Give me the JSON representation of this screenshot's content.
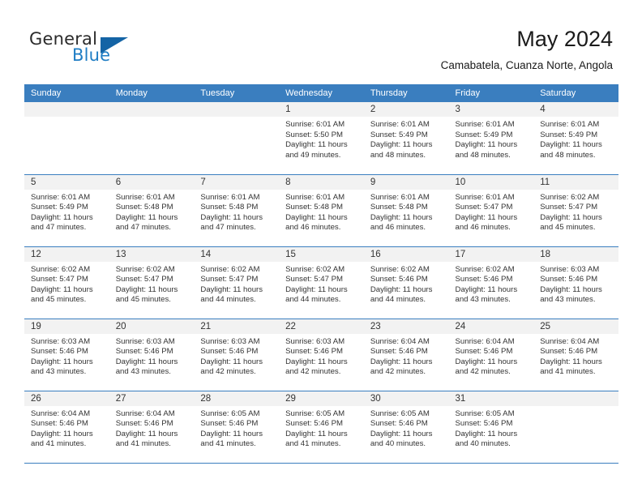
{
  "brand": {
    "name_part1": "General",
    "name_part2": "Blue"
  },
  "header": {
    "title": "May 2024",
    "subtitle": "Camabatela, Cuanza Norte, Angola"
  },
  "colors": {
    "header_blue": "#3a7ebf",
    "band_gray": "#f2f2f2",
    "brand_blue": "#1f7dc4",
    "text": "#333333"
  },
  "weekday_headers": [
    "Sunday",
    "Monday",
    "Tuesday",
    "Wednesday",
    "Thursday",
    "Friday",
    "Saturday"
  ],
  "weeks": [
    [
      {
        "day": "",
        "sunrise": "",
        "sunset": "",
        "daylight_line1": "",
        "daylight_line2": ""
      },
      {
        "day": "",
        "sunrise": "",
        "sunset": "",
        "daylight_line1": "",
        "daylight_line2": ""
      },
      {
        "day": "",
        "sunrise": "",
        "sunset": "",
        "daylight_line1": "",
        "daylight_line2": ""
      },
      {
        "day": "1",
        "sunrise": "Sunrise: 6:01 AM",
        "sunset": "Sunset: 5:50 PM",
        "daylight_line1": "Daylight: 11 hours",
        "daylight_line2": "and 49 minutes."
      },
      {
        "day": "2",
        "sunrise": "Sunrise: 6:01 AM",
        "sunset": "Sunset: 5:49 PM",
        "daylight_line1": "Daylight: 11 hours",
        "daylight_line2": "and 48 minutes."
      },
      {
        "day": "3",
        "sunrise": "Sunrise: 6:01 AM",
        "sunset": "Sunset: 5:49 PM",
        "daylight_line1": "Daylight: 11 hours",
        "daylight_line2": "and 48 minutes."
      },
      {
        "day": "4",
        "sunrise": "Sunrise: 6:01 AM",
        "sunset": "Sunset: 5:49 PM",
        "daylight_line1": "Daylight: 11 hours",
        "daylight_line2": "and 48 minutes."
      }
    ],
    [
      {
        "day": "5",
        "sunrise": "Sunrise: 6:01 AM",
        "sunset": "Sunset: 5:49 PM",
        "daylight_line1": "Daylight: 11 hours",
        "daylight_line2": "and 47 minutes."
      },
      {
        "day": "6",
        "sunrise": "Sunrise: 6:01 AM",
        "sunset": "Sunset: 5:48 PM",
        "daylight_line1": "Daylight: 11 hours",
        "daylight_line2": "and 47 minutes."
      },
      {
        "day": "7",
        "sunrise": "Sunrise: 6:01 AM",
        "sunset": "Sunset: 5:48 PM",
        "daylight_line1": "Daylight: 11 hours",
        "daylight_line2": "and 47 minutes."
      },
      {
        "day": "8",
        "sunrise": "Sunrise: 6:01 AM",
        "sunset": "Sunset: 5:48 PM",
        "daylight_line1": "Daylight: 11 hours",
        "daylight_line2": "and 46 minutes."
      },
      {
        "day": "9",
        "sunrise": "Sunrise: 6:01 AM",
        "sunset": "Sunset: 5:48 PM",
        "daylight_line1": "Daylight: 11 hours",
        "daylight_line2": "and 46 minutes."
      },
      {
        "day": "10",
        "sunrise": "Sunrise: 6:01 AM",
        "sunset": "Sunset: 5:47 PM",
        "daylight_line1": "Daylight: 11 hours",
        "daylight_line2": "and 46 minutes."
      },
      {
        "day": "11",
        "sunrise": "Sunrise: 6:02 AM",
        "sunset": "Sunset: 5:47 PM",
        "daylight_line1": "Daylight: 11 hours",
        "daylight_line2": "and 45 minutes."
      }
    ],
    [
      {
        "day": "12",
        "sunrise": "Sunrise: 6:02 AM",
        "sunset": "Sunset: 5:47 PM",
        "daylight_line1": "Daylight: 11 hours",
        "daylight_line2": "and 45 minutes."
      },
      {
        "day": "13",
        "sunrise": "Sunrise: 6:02 AM",
        "sunset": "Sunset: 5:47 PM",
        "daylight_line1": "Daylight: 11 hours",
        "daylight_line2": "and 45 minutes."
      },
      {
        "day": "14",
        "sunrise": "Sunrise: 6:02 AM",
        "sunset": "Sunset: 5:47 PM",
        "daylight_line1": "Daylight: 11 hours",
        "daylight_line2": "and 44 minutes."
      },
      {
        "day": "15",
        "sunrise": "Sunrise: 6:02 AM",
        "sunset": "Sunset: 5:47 PM",
        "daylight_line1": "Daylight: 11 hours",
        "daylight_line2": "and 44 minutes."
      },
      {
        "day": "16",
        "sunrise": "Sunrise: 6:02 AM",
        "sunset": "Sunset: 5:46 PM",
        "daylight_line1": "Daylight: 11 hours",
        "daylight_line2": "and 44 minutes."
      },
      {
        "day": "17",
        "sunrise": "Sunrise: 6:02 AM",
        "sunset": "Sunset: 5:46 PM",
        "daylight_line1": "Daylight: 11 hours",
        "daylight_line2": "and 43 minutes."
      },
      {
        "day": "18",
        "sunrise": "Sunrise: 6:03 AM",
        "sunset": "Sunset: 5:46 PM",
        "daylight_line1": "Daylight: 11 hours",
        "daylight_line2": "and 43 minutes."
      }
    ],
    [
      {
        "day": "19",
        "sunrise": "Sunrise: 6:03 AM",
        "sunset": "Sunset: 5:46 PM",
        "daylight_line1": "Daylight: 11 hours",
        "daylight_line2": "and 43 minutes."
      },
      {
        "day": "20",
        "sunrise": "Sunrise: 6:03 AM",
        "sunset": "Sunset: 5:46 PM",
        "daylight_line1": "Daylight: 11 hours",
        "daylight_line2": "and 43 minutes."
      },
      {
        "day": "21",
        "sunrise": "Sunrise: 6:03 AM",
        "sunset": "Sunset: 5:46 PM",
        "daylight_line1": "Daylight: 11 hours",
        "daylight_line2": "and 42 minutes."
      },
      {
        "day": "22",
        "sunrise": "Sunrise: 6:03 AM",
        "sunset": "Sunset: 5:46 PM",
        "daylight_line1": "Daylight: 11 hours",
        "daylight_line2": "and 42 minutes."
      },
      {
        "day": "23",
        "sunrise": "Sunrise: 6:04 AM",
        "sunset": "Sunset: 5:46 PM",
        "daylight_line1": "Daylight: 11 hours",
        "daylight_line2": "and 42 minutes."
      },
      {
        "day": "24",
        "sunrise": "Sunrise: 6:04 AM",
        "sunset": "Sunset: 5:46 PM",
        "daylight_line1": "Daylight: 11 hours",
        "daylight_line2": "and 42 minutes."
      },
      {
        "day": "25",
        "sunrise": "Sunrise: 6:04 AM",
        "sunset": "Sunset: 5:46 PM",
        "daylight_line1": "Daylight: 11 hours",
        "daylight_line2": "and 41 minutes."
      }
    ],
    [
      {
        "day": "26",
        "sunrise": "Sunrise: 6:04 AM",
        "sunset": "Sunset: 5:46 PM",
        "daylight_line1": "Daylight: 11 hours",
        "daylight_line2": "and 41 minutes."
      },
      {
        "day": "27",
        "sunrise": "Sunrise: 6:04 AM",
        "sunset": "Sunset: 5:46 PM",
        "daylight_line1": "Daylight: 11 hours",
        "daylight_line2": "and 41 minutes."
      },
      {
        "day": "28",
        "sunrise": "Sunrise: 6:05 AM",
        "sunset": "Sunset: 5:46 PM",
        "daylight_line1": "Daylight: 11 hours",
        "daylight_line2": "and 41 minutes."
      },
      {
        "day": "29",
        "sunrise": "Sunrise: 6:05 AM",
        "sunset": "Sunset: 5:46 PM",
        "daylight_line1": "Daylight: 11 hours",
        "daylight_line2": "and 41 minutes."
      },
      {
        "day": "30",
        "sunrise": "Sunrise: 6:05 AM",
        "sunset": "Sunset: 5:46 PM",
        "daylight_line1": "Daylight: 11 hours",
        "daylight_line2": "and 40 minutes."
      },
      {
        "day": "31",
        "sunrise": "Sunrise: 6:05 AM",
        "sunset": "Sunset: 5:46 PM",
        "daylight_line1": "Daylight: 11 hours",
        "daylight_line2": "and 40 minutes."
      },
      {
        "day": "",
        "sunrise": "",
        "sunset": "",
        "daylight_line1": "",
        "daylight_line2": ""
      }
    ]
  ]
}
